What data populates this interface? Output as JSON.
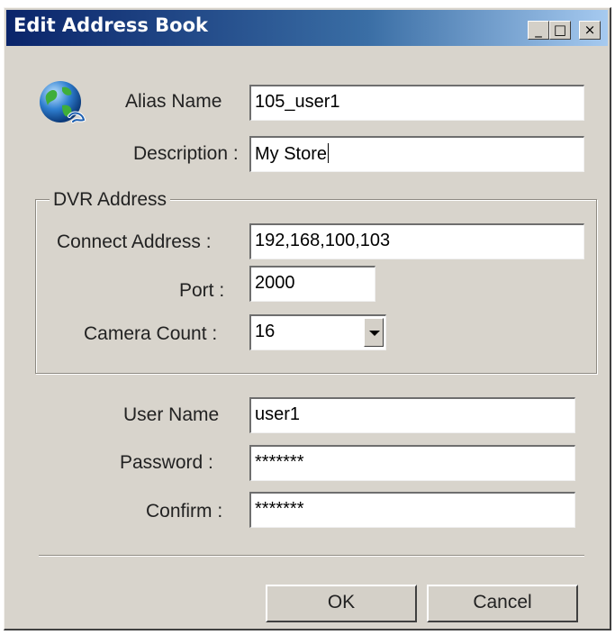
{
  "window": {
    "title": "Edit Address Book",
    "controls": {
      "minimize": "_",
      "maximize": "□",
      "close": "×"
    }
  },
  "icon": "globe-network-icon",
  "form": {
    "alias": {
      "label": "Alias Name",
      "value": "105_user1"
    },
    "description": {
      "label": "Description :",
      "value": "My Store"
    },
    "dvr_group": {
      "label": "DVR Address",
      "connect_address": {
        "label": "Connect Address :",
        "value": "192,168,100,103"
      },
      "port": {
        "label": "Port :",
        "value": "2000"
      },
      "camera_count": {
        "label": "Camera Count :",
        "value": "16"
      }
    },
    "user_name": {
      "label": "User Name",
      "value": "user1"
    },
    "password": {
      "label": "Password :",
      "value": "*******"
    },
    "confirm": {
      "label": "Confirm :",
      "value": "*******"
    }
  },
  "buttons": {
    "ok": "OK",
    "cancel": "Cancel"
  }
}
